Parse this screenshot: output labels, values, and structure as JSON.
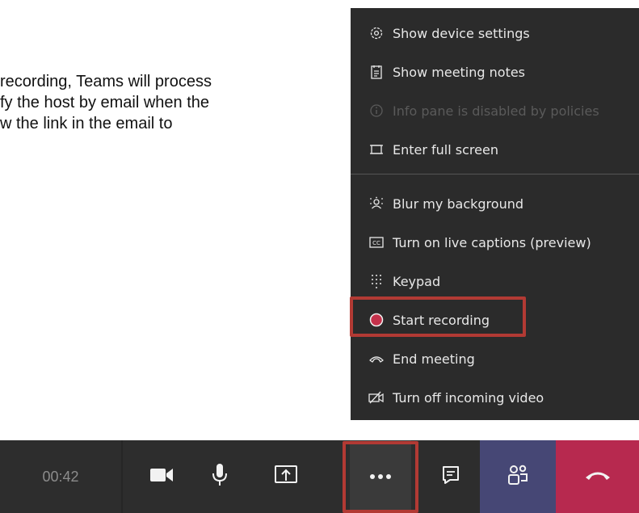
{
  "intro": {
    "lines": [
      "recording, Teams will process",
      "fy the host by email when the",
      "w the link in the email to"
    ]
  },
  "menu": {
    "items": [
      {
        "label": "Show device settings",
        "icon": "gear-icon",
        "enabled": true
      },
      {
        "label": "Show meeting notes",
        "icon": "notes-icon",
        "enabled": true
      },
      {
        "label": "Info pane is disabled by policies",
        "icon": "info-icon",
        "enabled": false
      },
      {
        "label": "Enter full screen",
        "icon": "fullscreen-icon",
        "enabled": true
      },
      {
        "label": "Blur my background",
        "icon": "blur-background-icon",
        "enabled": true
      },
      {
        "label": "Turn on live captions (preview)",
        "icon": "captions-icon",
        "enabled": true
      },
      {
        "label": "Keypad",
        "icon": "keypad-icon",
        "enabled": true
      },
      {
        "label": "Start recording",
        "icon": "record-icon",
        "enabled": true
      },
      {
        "label": "End meeting",
        "icon": "phone-hangup-icon",
        "enabled": true
      },
      {
        "label": "Turn off incoming video",
        "icon": "video-off-icon",
        "enabled": true
      }
    ]
  },
  "toolbar": {
    "timer": "00:42",
    "buttons": [
      {
        "icon": "video-camera-icon"
      },
      {
        "icon": "microphone-icon"
      },
      {
        "icon": "share-screen-icon"
      },
      {
        "icon": "more-options-icon"
      },
      {
        "icon": "chat-icon"
      },
      {
        "icon": "participants-icon"
      },
      {
        "icon": "hang-up-icon"
      }
    ]
  },
  "colors": {
    "menu_bg": "#2b2b2b",
    "toolbar_bg": "#2d2d2d",
    "highlight": "#b23a34",
    "record": "#c4314b",
    "hangup": "#b7294f",
    "participants": "#464775"
  }
}
